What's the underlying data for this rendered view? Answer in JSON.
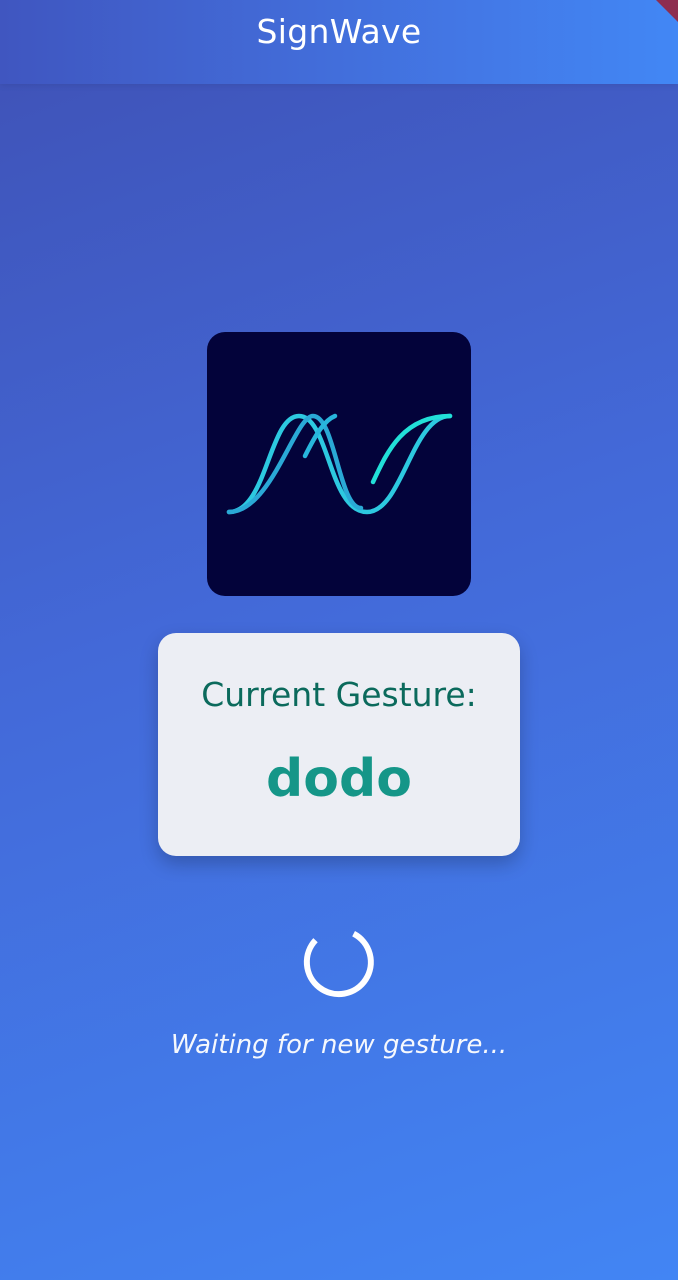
{
  "app_bar": {
    "title": "SignWave"
  },
  "logo": {
    "icon": "signwave-logo-icon",
    "background_color": "#03033a",
    "stroke_color": "#2dc9e0"
  },
  "gesture_card": {
    "heading": "Current Gesture:",
    "value": "dodo",
    "heading_color": "#0b6a5c",
    "value_color": "#159688"
  },
  "status": {
    "icon": "loading-spinner-icon",
    "text": "Waiting for new gesture..."
  }
}
